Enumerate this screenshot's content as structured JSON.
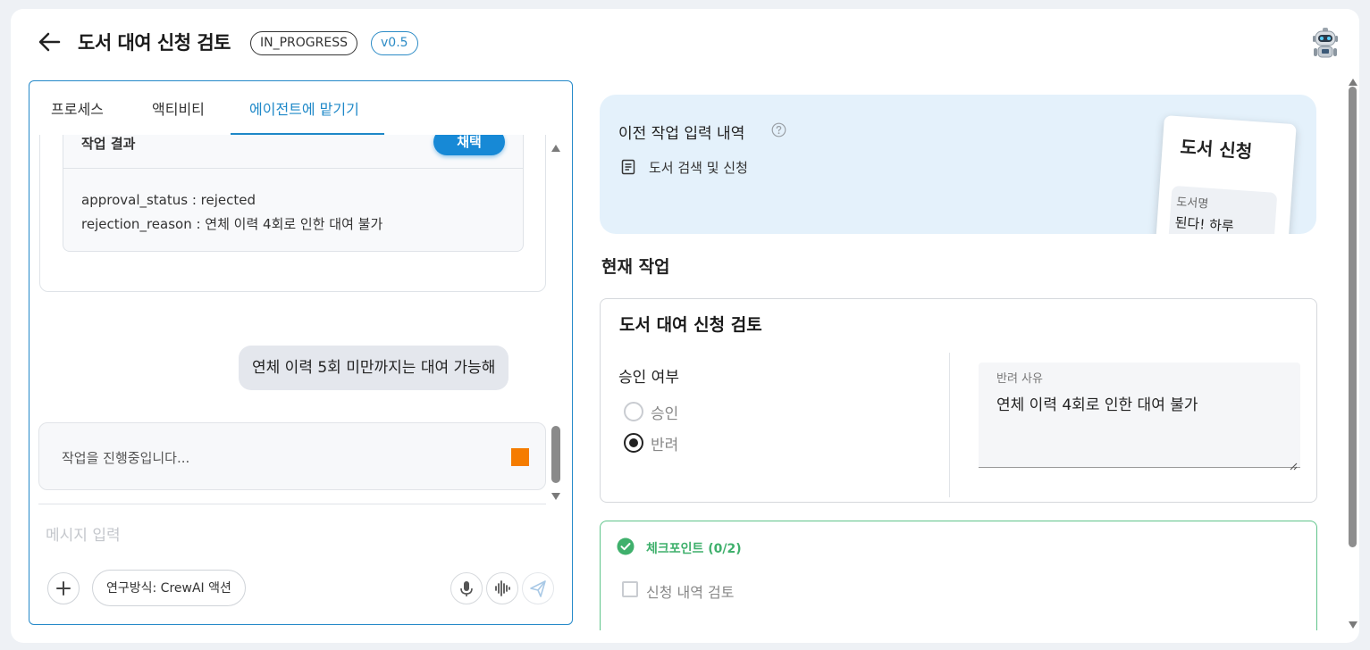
{
  "header": {
    "title": "도서 대여 신청 검토",
    "status": "IN_PROGRESS",
    "version": "v0.5"
  },
  "tabs": [
    {
      "label": "프로세스",
      "active": false
    },
    {
      "label": "액티비티",
      "active": false
    },
    {
      "label": "에이전트에 맡기기",
      "active": true
    }
  ],
  "result": {
    "title": "작업 결과",
    "adopt_label": "채택",
    "lines": [
      "approval_status : rejected",
      "rejection_reason : 연체 이력 4회로 인한 대여 불가"
    ]
  },
  "chat": {
    "user_message": "연체 이력 5회 미만까지는 대여 가능해",
    "progress_text": "작업을 진행중입니다...",
    "input_placeholder": "메시지 입력",
    "mode_label": "연구방식: CrewAI 액션"
  },
  "previous": {
    "title": "이전 작업 입력 내역",
    "item": "도서 검색 및 신청",
    "preview": {
      "title": "도서 신청",
      "field_label": "도서명",
      "field_value": "된다! 하루"
    }
  },
  "current": {
    "section_title": "현재 작업",
    "form_title": "도서 대여 신청 검토",
    "approval_label": "승인 여부",
    "options": [
      {
        "label": "승인",
        "checked": false
      },
      {
        "label": "반려",
        "checked": true
      }
    ],
    "reason_label": "반려 사유",
    "reason_value": "연체 이력 4회로 인한 대여 불가"
  },
  "checkpoint": {
    "title": "체크포인트 (0/2)",
    "items": [
      "신청 내역 검토"
    ]
  },
  "colors": {
    "accent": "#1e88c8",
    "stop": "#f57c00",
    "check": "#3fb06c"
  }
}
